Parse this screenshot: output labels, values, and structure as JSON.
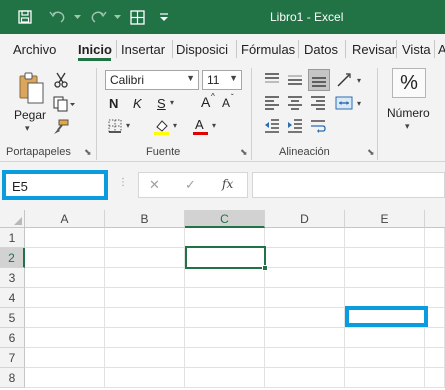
{
  "window": {
    "title": "Libro1  -  Excel"
  },
  "quick_access": {
    "save_icon": "save-icon",
    "undo_icon": "undo-icon",
    "redo_icon": "redo-icon",
    "grid_icon": "borders-icon",
    "customize_icon": "customize-icon"
  },
  "tabs": [
    {
      "label": "Archivo"
    },
    {
      "label": "Inicio"
    },
    {
      "label": "Insertar"
    },
    {
      "label": "Disposici"
    },
    {
      "label": "Fórmulas"
    },
    {
      "label": "Datos"
    },
    {
      "label": "Revisar"
    },
    {
      "label": "Vista"
    },
    {
      "label": "A"
    }
  ],
  "ribbon": {
    "clipboard": {
      "paste_label": "Pegar",
      "group_label": "Portapapeles"
    },
    "font": {
      "font_name": "Calibri",
      "font_size": "11",
      "bold": "N",
      "italic": "K",
      "underline": "S",
      "grow": "A",
      "shrink": "A",
      "font_color_letter": "A",
      "group_label": "Fuente",
      "colors": {
        "highlight": "#ffff00",
        "font": "#e00000"
      }
    },
    "alignment": {
      "group_label": "Alineación"
    },
    "number": {
      "symbol": "%",
      "label": "Número"
    }
  },
  "formula_bar": {
    "name_box": "E5",
    "cancel": "✕",
    "enter": "✓",
    "fx": "fx",
    "formula": ""
  },
  "sheet": {
    "columns": [
      "A",
      "B",
      "C",
      "D",
      "E"
    ],
    "rows": [
      "1",
      "2",
      "3",
      "4",
      "5",
      "6",
      "7",
      "8"
    ],
    "active_cell": "C2",
    "selected_column": "C",
    "selected_row": "2"
  },
  "colors": {
    "accent": "#217346",
    "highlight": "#0b9ce0"
  }
}
